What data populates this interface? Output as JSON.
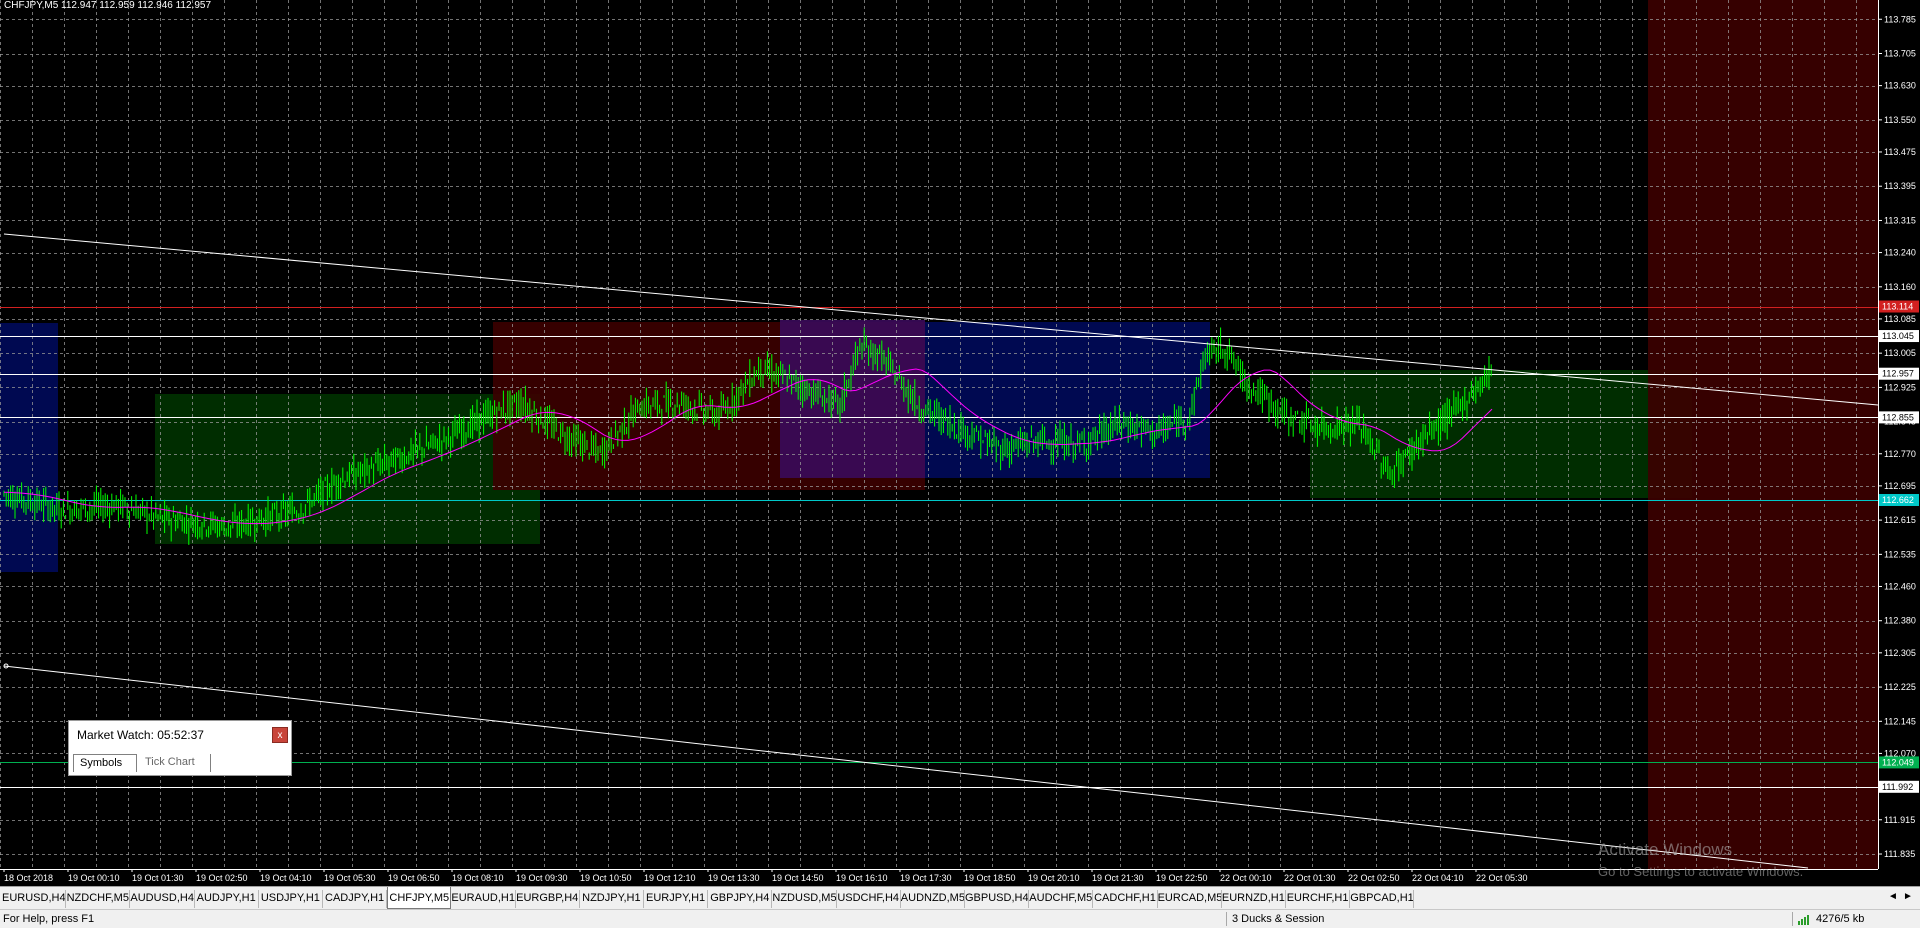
{
  "chart": {
    "symbol_info": "CHFJPY,M5  112.947 112.959 112.946 112.957",
    "colors": {
      "background": "#000000",
      "grid": "#9a9a9a",
      "bull_candle": "#00ff00",
      "moving_average": "#ff00ff",
      "trendline": "#ffffff",
      "line_red": "#d22020",
      "line_cyan": "#00c8c8",
      "line_green": "#00b050",
      "box_blue": "#000a5a",
      "box_red": "#3c0000",
      "box_green": "#003200",
      "box_purple": "#3a0a5a"
    },
    "price_axis": {
      "min": 111.8,
      "max": 113.83,
      "ticks": [
        "113.785",
        "113.705",
        "113.630",
        "113.550",
        "113.475",
        "113.395",
        "113.315",
        "113.240",
        "113.160",
        "113.085",
        "113.005",
        "112.925",
        "112.845",
        "112.770",
        "112.695",
        "112.615",
        "112.535",
        "112.460",
        "112.380",
        "112.305",
        "112.225",
        "112.145",
        "112.070",
        "111.992",
        "111.915",
        "111.835"
      ]
    },
    "level_labels": [
      {
        "price": 113.114,
        "label": "113.114",
        "color": "#d22020"
      },
      {
        "price": 113.045,
        "label": "113.045",
        "color": "#ffffff"
      },
      {
        "price": 112.957,
        "label": "112.957",
        "color": "#ffffff"
      },
      {
        "price": 112.855,
        "label": "112.855",
        "color": "#ffffff"
      },
      {
        "price": 112.662,
        "label": "112.662",
        "color": "#00c8c8"
      },
      {
        "price": 112.049,
        "label": "112.049",
        "color": "#00b050"
      },
      {
        "price": 111.992,
        "label": "111.992",
        "color": "#ffffff"
      }
    ],
    "time_axis": [
      "18 Oct 2018",
      "19 Oct 00:10",
      "19 Oct 01:30",
      "19 Oct 02:50",
      "19 Oct 04:10",
      "19 Oct 05:30",
      "19 Oct 06:50",
      "19 Oct 08:10",
      "19 Oct 09:30",
      "19 Oct 10:50",
      "19 Oct 12:10",
      "19 Oct 13:30",
      "19 Oct 14:50",
      "19 Oct 16:10",
      "19 Oct 17:30",
      "19 Oct 18:50",
      "19 Oct 20:10",
      "19 Oct 21:30",
      "19 Oct 22:50",
      "22 Oct 00:10",
      "22 Oct 01:30",
      "22 Oct 02:50",
      "22 Oct 04:10",
      "22 Oct 05:30"
    ]
  },
  "market_watch": {
    "title": "Market Watch: 05:52:37",
    "close_label": "x",
    "tabs": [
      "Symbols",
      "Tick Chart"
    ]
  },
  "tabs": [
    {
      "label": "EURUSD,H4"
    },
    {
      "label": "NZDCHF,M5"
    },
    {
      "label": "AUDUSD,H4"
    },
    {
      "label": "AUDJPY,H1"
    },
    {
      "label": "USDJPY,H1"
    },
    {
      "label": "CADJPY,H1"
    },
    {
      "label": "CHFJPY,M5",
      "active": true
    },
    {
      "label": "EURAUD,H1"
    },
    {
      "label": "EURGBP,H4"
    },
    {
      "label": "NZDJPY,H1"
    },
    {
      "label": "EURJPY,H1"
    },
    {
      "label": "GBPJPY,H4"
    },
    {
      "label": "NZDUSD,M5"
    },
    {
      "label": "USDCHF,H4"
    },
    {
      "label": "AUDNZD,M5"
    },
    {
      "label": "GBPUSD,H4"
    },
    {
      "label": "AUDCHF,M5"
    },
    {
      "label": "CADCHF,H1"
    },
    {
      "label": "EURCAD,M5"
    },
    {
      "label": "EURNZD,H1"
    },
    {
      "label": "EURCHF,H1"
    },
    {
      "label": "GBPCAD,H1"
    }
  ],
  "tab_nav": {
    "prev": "◄",
    "next": "►"
  },
  "status": {
    "help": "For Help, press F1",
    "profile": "3 Ducks & Session",
    "traffic": "4276/5 kb"
  },
  "watermark": {
    "title": "Activate Windows",
    "subtitle": "Go to Settings to activate Windows."
  }
}
